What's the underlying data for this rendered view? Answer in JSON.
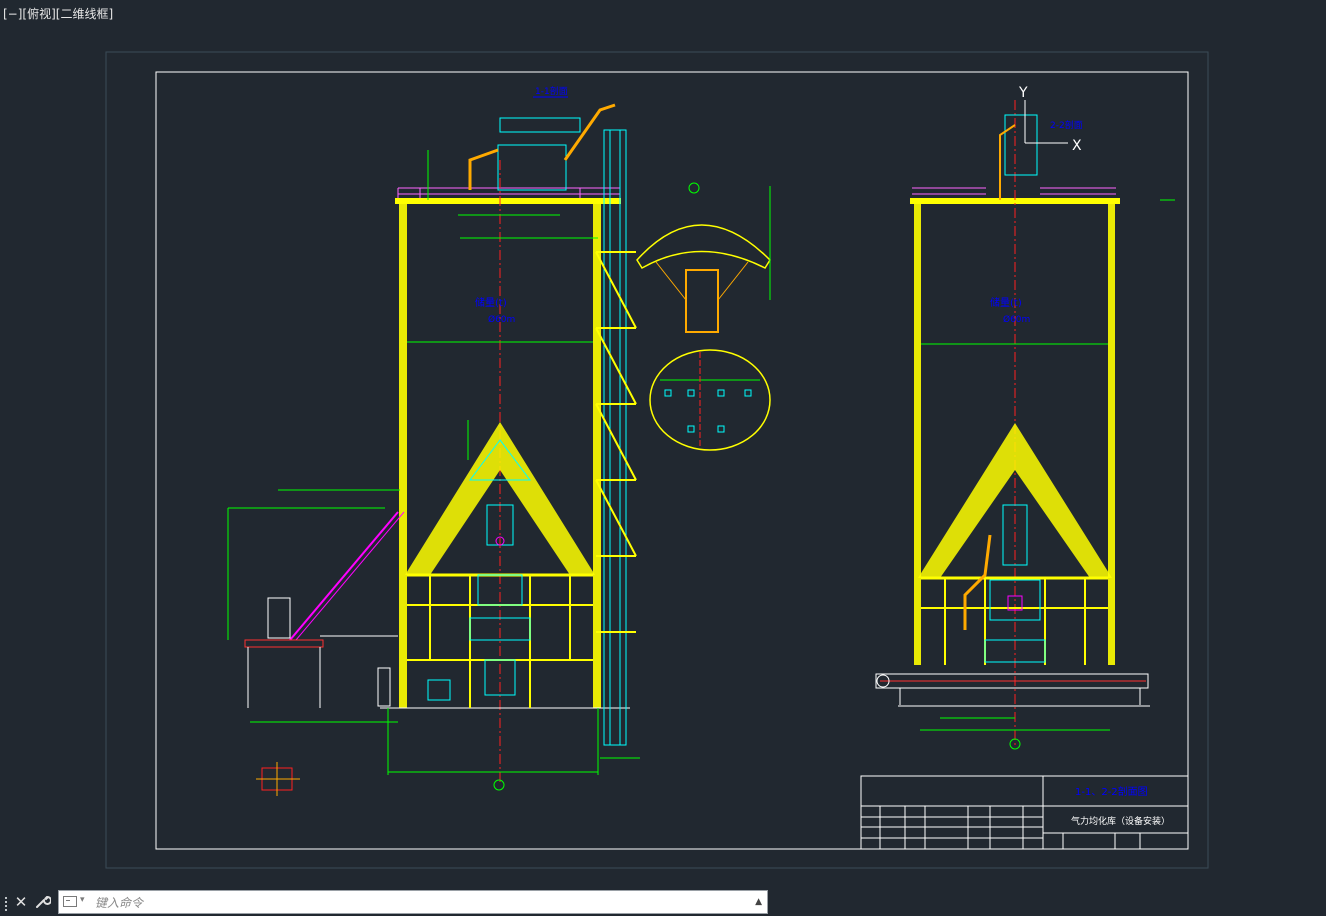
{
  "viewport": {
    "label": "[−][俯视][二维线框]",
    "parts": [
      "[−]",
      "[俯视]",
      "[二维线框]"
    ]
  },
  "drawing": {
    "section_a_title": "1-1剖面",
    "section_b_title": "2-2剖面",
    "silo_a_label_1": "储量(t)",
    "silo_a_label_2": "Ø60m",
    "silo_b_label_1": "储量(t)",
    "silo_b_label_2": "Ø60m",
    "axis_y": "Y",
    "axis_x": "X",
    "axis_1": "①",
    "title_block": {
      "sheet_title": "1-1、2-2剖面图",
      "project_name": "气力均化库（设备安装）"
    }
  },
  "command_line": {
    "placeholder": "键入命令",
    "close_icon": "close-icon",
    "customize_icon": "wrench-icon",
    "up_icon": "triangle-up-icon"
  },
  "colors": {
    "background": "#212830",
    "paper_frame": "#ffffff",
    "structure": "#ffff00",
    "dimension": "#00ff00",
    "equipment": "#00ffff",
    "annotation": "#0000ff",
    "centerline": "#ff0000",
    "railing": "#ff00ff"
  }
}
